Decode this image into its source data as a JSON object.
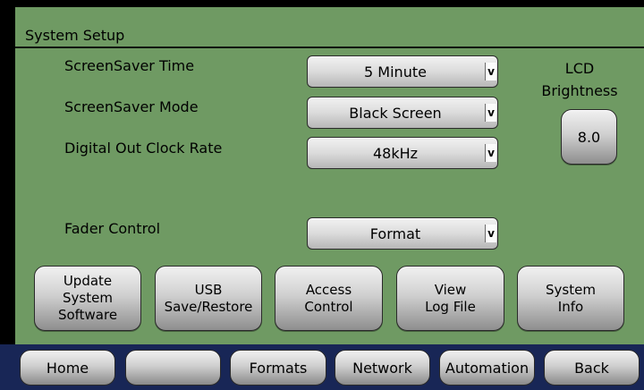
{
  "panel": {
    "title": "System Setup"
  },
  "settings": [
    {
      "label": "ScreenSaver Time",
      "value": "5 Minute"
    },
    {
      "label": "ScreenSaver Mode",
      "value": "Black Screen"
    },
    {
      "label": "Digital Out Clock Rate",
      "value": "48kHz"
    },
    {
      "label": "Fader Control",
      "value": "Format"
    }
  ],
  "dropdown_arrow_glyph": "v",
  "lcd": {
    "label_line1": "LCD",
    "label_line2": "Brightness",
    "value": "8.0"
  },
  "actions": [
    {
      "label": "Update\nSystem\nSoftware",
      "icon": "none"
    },
    {
      "label": "USB\nSave/Restore",
      "icon": "none"
    },
    {
      "label": "Access\nControl",
      "icon": "none"
    },
    {
      "label": "View\nLog File",
      "icon": "none"
    },
    {
      "label": "System\nInfo",
      "icon": "none"
    }
  ],
  "nav": [
    {
      "label": "Home"
    },
    {
      "label": ""
    },
    {
      "label": "Formats"
    },
    {
      "label": "Network"
    },
    {
      "label": "Automation"
    },
    {
      "label": "Back"
    }
  ],
  "colors": {
    "panel_bg": "#6f9a63",
    "screen_bg": "#000000",
    "navbar_bg": "#182656",
    "button_face_top": "#f1f1f1",
    "button_face_bottom": "#8e8e8e",
    "text": "#000000"
  }
}
